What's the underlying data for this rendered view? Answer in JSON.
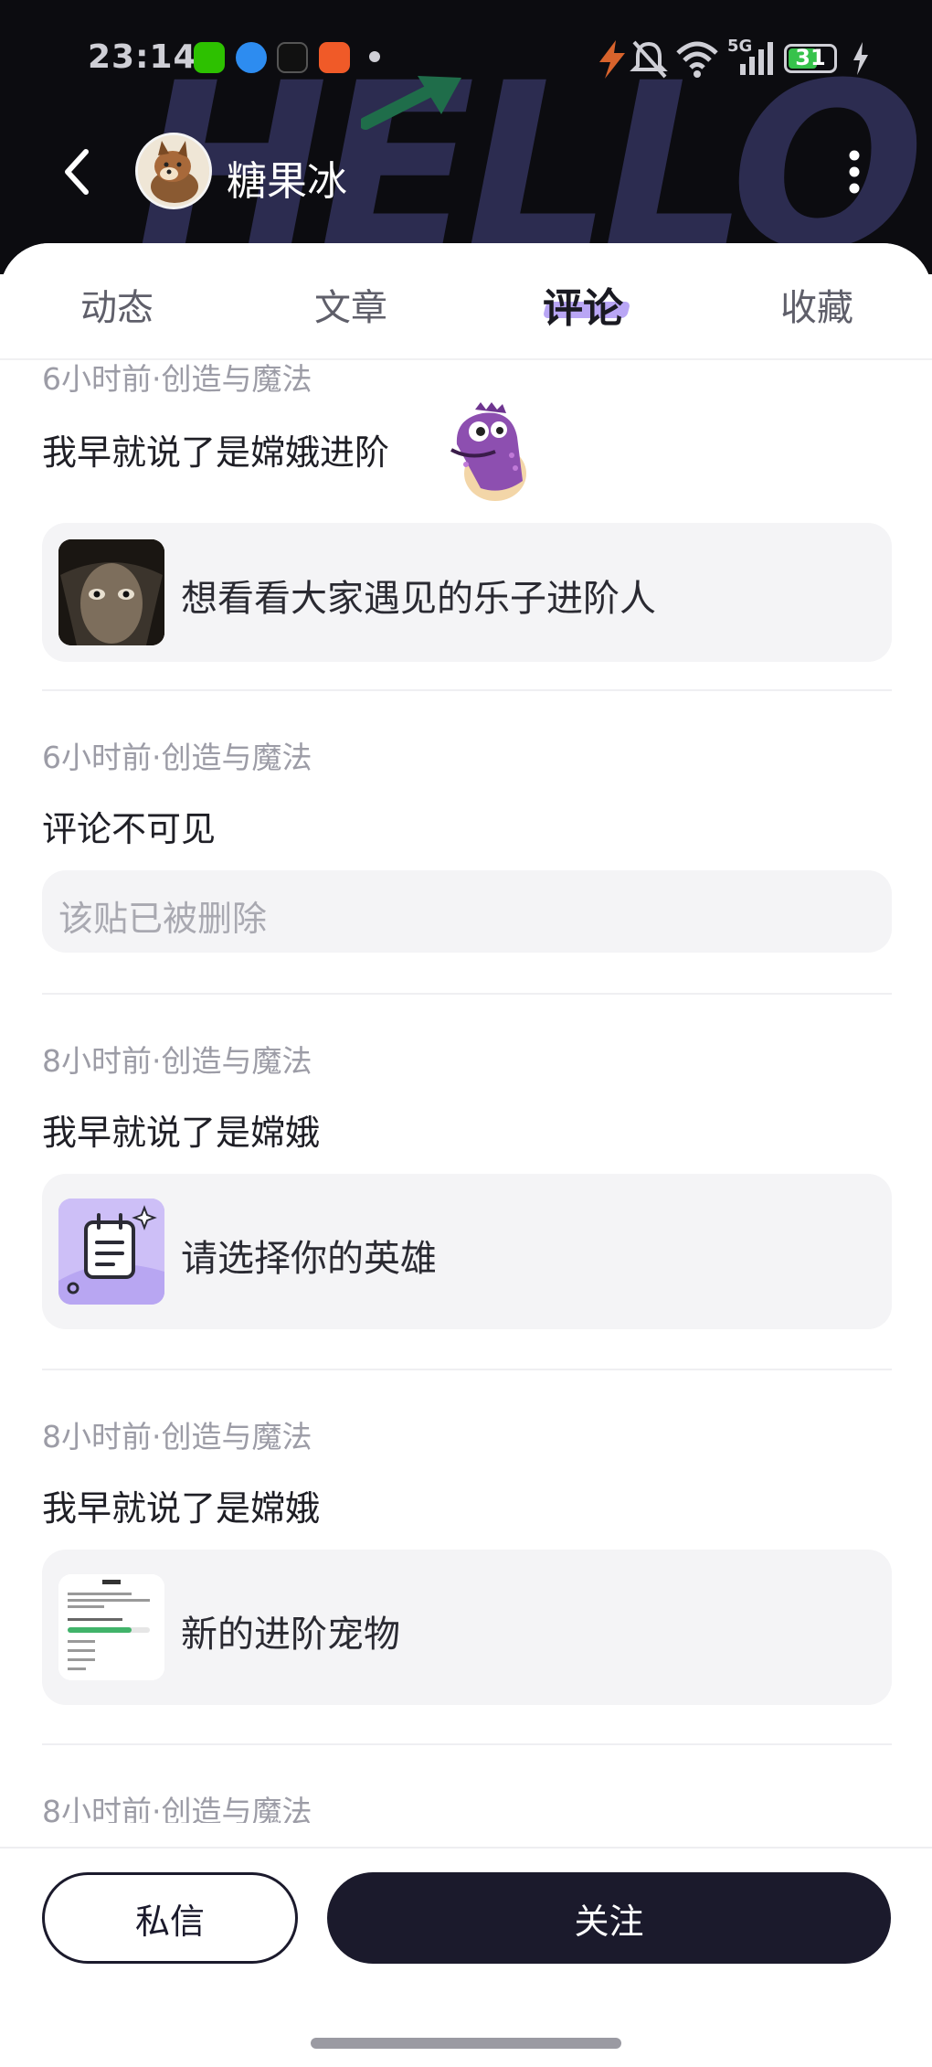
{
  "status_bar": {
    "time": "23:14",
    "battery": "31",
    "network": "5G",
    "accent": "#36c24b"
  },
  "profile": {
    "username": "糖果冰"
  },
  "banner": {
    "text": "HELLO"
  },
  "tabs": [
    {
      "label": "动态",
      "active": false
    },
    {
      "label": "文章",
      "active": false
    },
    {
      "label": "评论",
      "active": true
    },
    {
      "label": "收藏",
      "active": false
    }
  ],
  "comments": [
    {
      "meta": "6小时前·创造与魔法",
      "text": "我早就说了是嫦娥进阶",
      "sticker": "purple-dinosaur-sticker",
      "card_title": "想看看大家遇见的乐子进阶人",
      "thumb": "face-photo-thumbnail"
    },
    {
      "meta": "6小时前·创造与魔法",
      "text": "评论不可见",
      "card_title": "该贴已被删除"
    },
    {
      "meta": "8小时前·创造与魔法",
      "text": "我早就说了是嫦娥",
      "card_title": "请选择你的英雄",
      "thumb": "notepad-icon"
    },
    {
      "meta": "8小时前·创造与魔法",
      "text": "我早就说了是嫦娥",
      "card_title": "新的进阶宠物",
      "thumb": "document-screenshot-thumbnail"
    },
    {
      "meta": "8小时前·创造与魔法"
    }
  ],
  "actions": {
    "message_label": "私信",
    "follow_label": "关注"
  }
}
